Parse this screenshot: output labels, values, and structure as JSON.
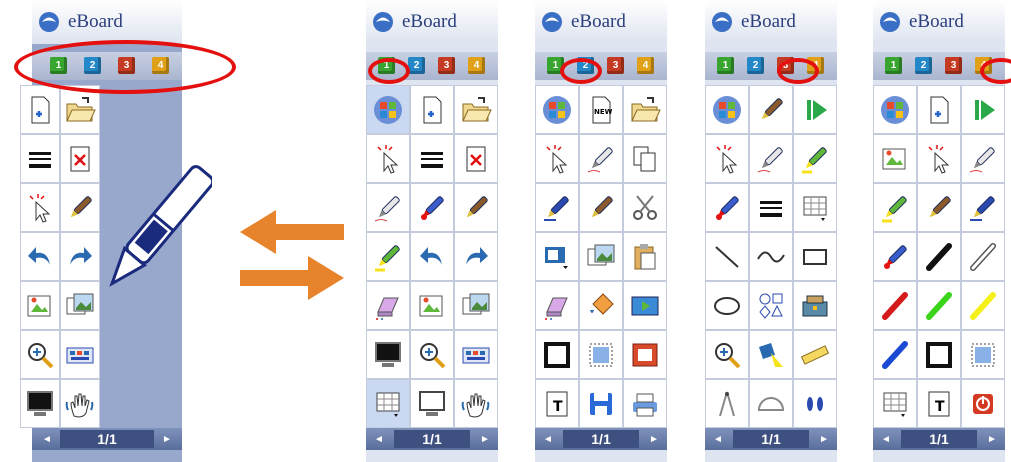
{
  "brand": {
    "name": "eBoard"
  },
  "tabs": [
    "1",
    "2",
    "3",
    "4"
  ],
  "pagination": {
    "prev_icon": "◄",
    "next_icon": "►",
    "page": "1/1"
  },
  "colors": {
    "highlight": "#e41010",
    "arrow": "#e7832a",
    "panel_bg": "#dfe5f0",
    "footer": "#5a6e9c"
  },
  "panels": [
    {
      "name": "toolbar-zoomed",
      "active_tab": 1,
      "icons": [
        "new-page-icon",
        "open-folder-icon",
        "lines-icon",
        "delete-page-icon",
        "pen-select-icon",
        "marker-icon",
        "undo-icon",
        "redo-icon",
        "insert-picture-icon",
        "gallery-icon",
        "magnifier-icon",
        "keyboard-icon",
        "screen-icon",
        "hand-icon"
      ]
    },
    {
      "name": "toolbar-tab-1",
      "active_tab": 1,
      "icons": [
        "windows-icon",
        "new-page-icon",
        "open-folder-icon",
        "select-icon",
        "lines-icon",
        "delete-page-icon",
        "pen-icon",
        "red-pen-icon",
        "marker-icon",
        "highlighter-icon",
        "undo-icon",
        "redo-icon",
        "eraser-icon",
        "insert-picture-icon",
        "gallery-icon",
        "screen-icon",
        "magnifier-icon",
        "keyboard-icon",
        "screen-grid-icon",
        "whiteboard-icon",
        "hand-icon"
      ]
    },
    {
      "name": "toolbar-tab-2",
      "active_tab": 2,
      "icons": [
        "windows-icon",
        "new-icon",
        "open-folder-icon",
        "select-icon",
        "pen-icon",
        "copy-icon",
        "signature-icon",
        "marker-icon",
        "scissors-icon",
        "picture-menu-icon",
        "gallery-icon",
        "paste-icon",
        "eraser-icon",
        "fill-icon",
        "media-icon",
        "frame-icon",
        "pattern-icon",
        "record-icon",
        "text-icon",
        "save-icon",
        "print-icon"
      ]
    },
    {
      "name": "toolbar-tab-3",
      "active_tab": 3,
      "icons": [
        "windows-icon",
        "marker-icon",
        "play-icon",
        "select-icon",
        "pen-icon",
        "highlighter-icon",
        "red-pen-icon",
        "lines-icon",
        "grid-menu-icon",
        "line-icon",
        "curve-icon",
        "rectangle-icon",
        "ellipse-icon",
        "shapes-icon",
        "toolbox-icon",
        "magnifier-icon",
        "spotlight-icon",
        "ruler-icon",
        "compass-icon",
        "protractor-icon",
        "footprints-icon"
      ]
    },
    {
      "name": "toolbar-tab-4",
      "active_tab": 4,
      "icons": [
        "windows-icon",
        "new-page-icon",
        "play-icon",
        "insert-picture-icon",
        "select-icon",
        "pen-icon",
        "highlighter-icon",
        "marker-icon",
        "signature-icon",
        "red-pen-icon",
        "black-pen-icon",
        "white-pen-icon",
        "red-line-icon",
        "green-line-icon",
        "yellow-line-icon",
        "blue-line-icon",
        "frame-icon",
        "pattern-icon",
        "grid-menu-icon",
        "text-icon",
        "power-icon"
      ]
    }
  ]
}
